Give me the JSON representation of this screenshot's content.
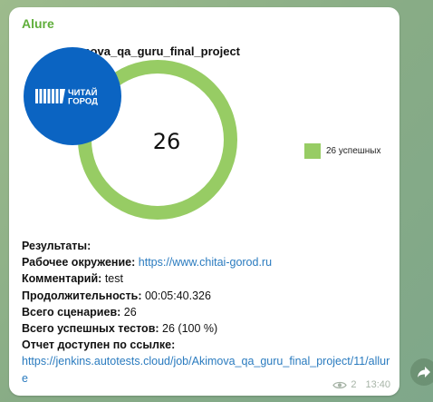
{
  "message": {
    "sender": "Alure",
    "chart_card": {
      "title_visible": "mova_qa_guru_final_project",
      "logo_text": "ЧИТАЙ ГОРОД",
      "center_value": "26",
      "legend_label": "26 успешных",
      "colors": {
        "passed": "#97cc64",
        "logo_blue": "#0b64c2"
      }
    },
    "info": {
      "results_label": "Результаты:",
      "env_label": "Рабочее окружение:",
      "env_url": "https://www.chitai-gorod.ru",
      "comment_label": "Комментарий:",
      "comment_value": "test",
      "duration_label": "Продолжительность:",
      "duration_value": "00:05:40.326",
      "scenarios_label": "Всего сценариев:",
      "scenarios_value": "26",
      "passed_label": "Всего успешных тестов:",
      "passed_value": "26 (100 %)",
      "report_label": "Отчет доступен по ссылке:",
      "report_url": "https://jenkins.autotests.cloud/job/Akimova_qa_guru_final_project/11/allure"
    },
    "meta": {
      "views": "2",
      "time": "13:40"
    }
  },
  "chart_data": {
    "type": "pie",
    "categories": [
      "успешных"
    ],
    "values": [
      26
    ],
    "center_label": "26",
    "legend": [
      "26 успешных"
    ],
    "colors": [
      "#97cc64"
    ]
  }
}
